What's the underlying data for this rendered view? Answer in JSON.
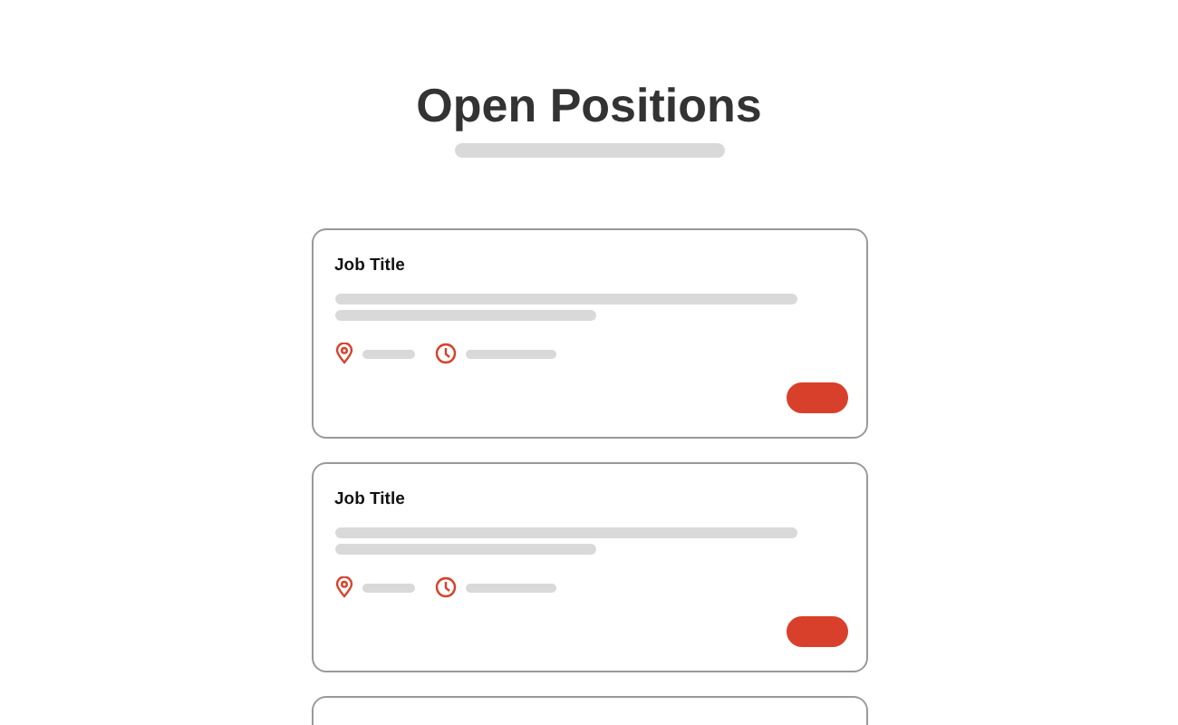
{
  "page": {
    "title": "Open Positions"
  },
  "jobs": [
    {
      "title": "Job Title"
    },
    {
      "title": "Job Title"
    }
  ]
}
